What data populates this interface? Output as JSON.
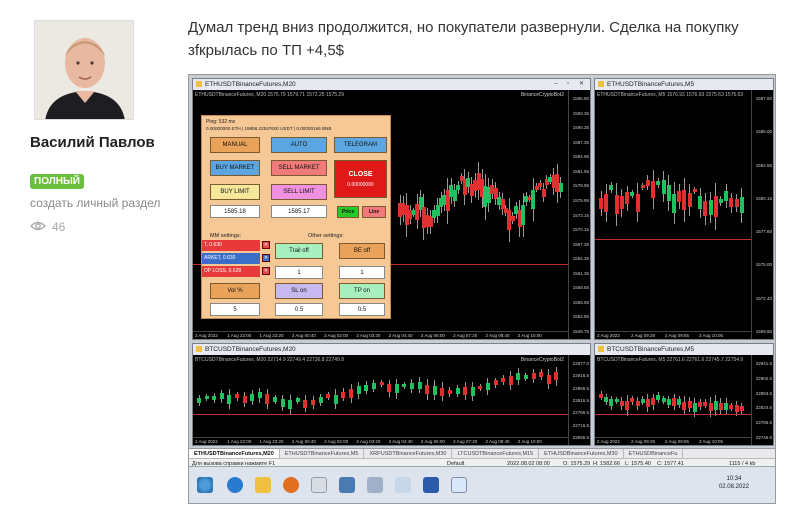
{
  "user": {
    "name": "Василий Павлов",
    "badge": "ПОЛНЫЙ",
    "create_link": "создать личный раздел",
    "views": "46"
  },
  "post": {
    "text": "Думал тренд вниз продолжится, но покупатели развернули. Сделка на покупку зfкрылась по ТП +4,5$"
  },
  "terminal": {
    "windows": [
      {
        "title": "ETHUSDTBinanceFutures,M20",
        "info": "ETHUSDTBinanceFutures, M20 1575.79 1579.71 1572.25 1575.29",
        "tag": "BinanceCryptoBot2",
        "prices": [
          "1595.80",
          "1593.35",
          "1590.35",
          "1587.35",
          "1584.95",
          "1581.95",
          "1578.95",
          "1575.95",
          "1573.15",
          "1570.15",
          "1567.35",
          "1564.35",
          "1561.35",
          "1558.55",
          "1555.55",
          "1552.55",
          "1549.75"
        ],
        "times": [
          "2 Aug 2022",
          "1 Aug 22:00",
          "1 Aug 23:20",
          "2 Aug 00:40",
          "2 Aug 02:00",
          "2 Aug 03:20",
          "2 Aug 04:40",
          "2 Aug 06:00",
          "2 Aug 07:20",
          "2 Aug 08:40",
          "2 Aug 10:00"
        ]
      },
      {
        "title": "ETHUSDTBinanceFutures,M5",
        "info": "ETHUSDTBinanceFutures, M5 1576.93 1576.93 1575.63 1575.63",
        "prices": [
          "1587.60",
          "1585.00",
          "1582.65",
          "1580.15",
          "1577.60",
          "1575.00",
          "1572.40",
          "1569.80"
        ],
        "times": [
          "2 Aug 2022",
          "2 Aug 09:25",
          "2 Aug 09:55",
          "2 Aug 10:05"
        ]
      },
      {
        "title": "BTCUSDTBinanceFutures,M20",
        "info": "BTCUSDTBinanceFutures, M20 22714.9 22749.4 22736.8 22749.8",
        "tag": "BinanceCryptoBot2",
        "prices": [
          "22977.0",
          "22916.5",
          "22866.5",
          "22816.5",
          "22766.5",
          "22716.5",
          "22665.5"
        ],
        "times": [
          "2 Aug 2022",
          "1 Aug 22:00",
          "1 Aug 23:20",
          "2 Aug 00:40",
          "2 Aug 02:00",
          "2 Aug 03:20",
          "2 Aug 04:40",
          "2 Aug 06:00",
          "2 Aug 07:20",
          "2 Aug 08:40",
          "2 Aug 10:00"
        ]
      },
      {
        "title": "BTCUSDTBinanceFutures,M5",
        "info": "BTCUSDTBinanceFutures, M5 22761.6 22761.6 22745.7 22754.9",
        "prices": [
          "22941.5",
          "22902.5",
          "22863.5",
          "22824.5",
          "22785.5",
          "22746.5"
        ],
        "times": [
          "2 Aug 2022",
          "2 Aug 09:25",
          "2 Aug 09:55",
          "2 Aug 10:05"
        ]
      }
    ],
    "panel": {
      "ping": "Ping: 532 ms",
      "balance": "0.00000000 ETH | 19856.22547600 USDT | 0.00000166 BNB",
      "buttons": [
        "MANUAL",
        "AUTO",
        "TELEGRAM",
        "BUY MARKET",
        "SELL MARKET",
        "BUY LIMIT",
        "SELL LIMIT"
      ],
      "close": "CLOSE",
      "close_value": "0.00000000",
      "buy_price": "1585.18",
      "sell_price": "1585.17",
      "price_btn": "Price",
      "line_btn": "Line",
      "mm_label": "MM settings:",
      "other_label": "Other settings:",
      "rows": [
        "T, 0.630",
        "ARKET, 0.630",
        "OP LOSS, 0.628"
      ],
      "trail": "Trail off",
      "be": "BE off",
      "qty1": "1",
      "qty2": "1",
      "vol": "Vol %",
      "sl": "SL on",
      "tp": "TP on",
      "v1": "5",
      "v2": "0.5",
      "v3": "0.5"
    },
    "tabs": [
      "ETHUSDTBinanceFutures,M20",
      "ETHUSDTBinanceFutures,M5",
      "XRPUSDTBinanceFutures,M30",
      "LTCUSDTBinanceFutures,M15",
      "ETHUSDBinanceFutures,M30",
      "ETHUSDBinanceFu"
    ],
    "status": {
      "help": "Для вызова справки нажмите F1",
      "profile": "Default",
      "datetime": "2022.08.02 08:00",
      "o": "O: 1575.29",
      "h": "H: 1582.66",
      "l": "L: 1575.40",
      "c": "C: 1577.41",
      "traffic": "1115 / 4 kb"
    },
    "clock": {
      "time": "10:34",
      "date": "02.08.2022"
    }
  }
}
